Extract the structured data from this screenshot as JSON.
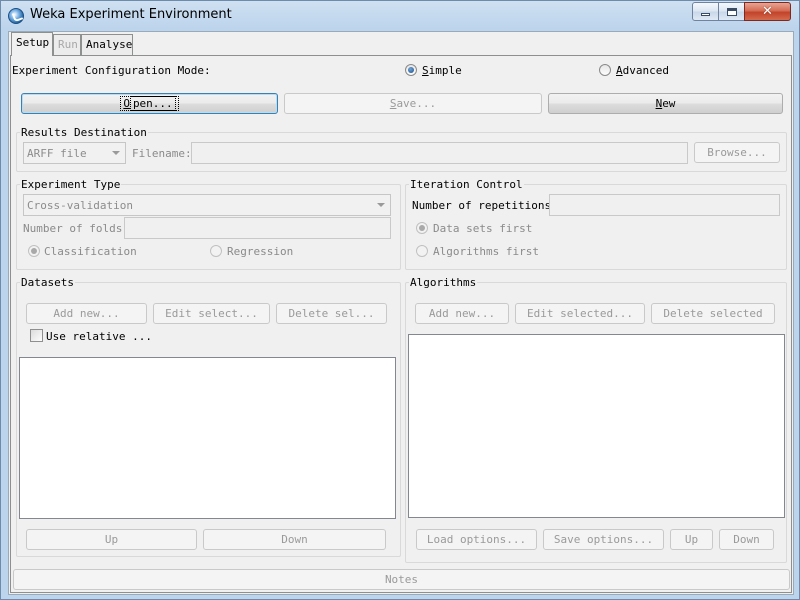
{
  "window": {
    "title": "Weka Experiment Environment",
    "close_symbol": "✕"
  },
  "tabs": [
    {
      "label": "Setup"
    },
    {
      "label": "Run"
    },
    {
      "label": "Analyse"
    }
  ],
  "config_mode": {
    "label": "Experiment Configuration Mode:",
    "simple_mnemonic": "S",
    "simple_rest": "imple",
    "simple_selected": true,
    "advanced_mnemonic": "A",
    "advanced_rest": "dvanced",
    "advanced_selected": false
  },
  "file_buttons": {
    "open_mnemonic": "O",
    "open_rest": "pen...",
    "save_mnemonic": "S",
    "save_rest": "ave...",
    "new_mnemonic": "N",
    "new_rest": "ew"
  },
  "results_destination": {
    "title": "Results Destination",
    "format": "ARFF file",
    "filename_label": "Filename:",
    "filename_value": "",
    "browse": "Browse..."
  },
  "experiment_type": {
    "title": "Experiment Type",
    "type": "Cross-validation",
    "folds_label": "Number of folds:",
    "folds_value": "",
    "classification": "Classification",
    "classification_selected": true,
    "regression": "Regression",
    "regression_selected": false
  },
  "iteration_control": {
    "title": "Iteration Control",
    "repetitions_label": "Number of repetitions:",
    "repetitions_value": "",
    "datasets_first": "Data sets first",
    "datasets_first_selected": true,
    "algorithms_first": "Algorithms first",
    "algorithms_first_selected": false
  },
  "datasets": {
    "title": "Datasets",
    "add_new": "Add new...",
    "edit_selected": "Edit select...",
    "delete_selected": "Delete sel...",
    "use_relative": "Use relative ...",
    "use_relative_checked": false,
    "items": [],
    "up": "Up",
    "down": "Down"
  },
  "algorithms": {
    "title": "Algorithms",
    "add_new": "Add new...",
    "edit_selected": "Edit selected...",
    "delete_selected": "Delete selected",
    "items": [],
    "load_options": "Load options...",
    "save_options": "Save options...",
    "up": "Up",
    "down": "Down"
  },
  "notes": {
    "label": "Notes"
  }
}
